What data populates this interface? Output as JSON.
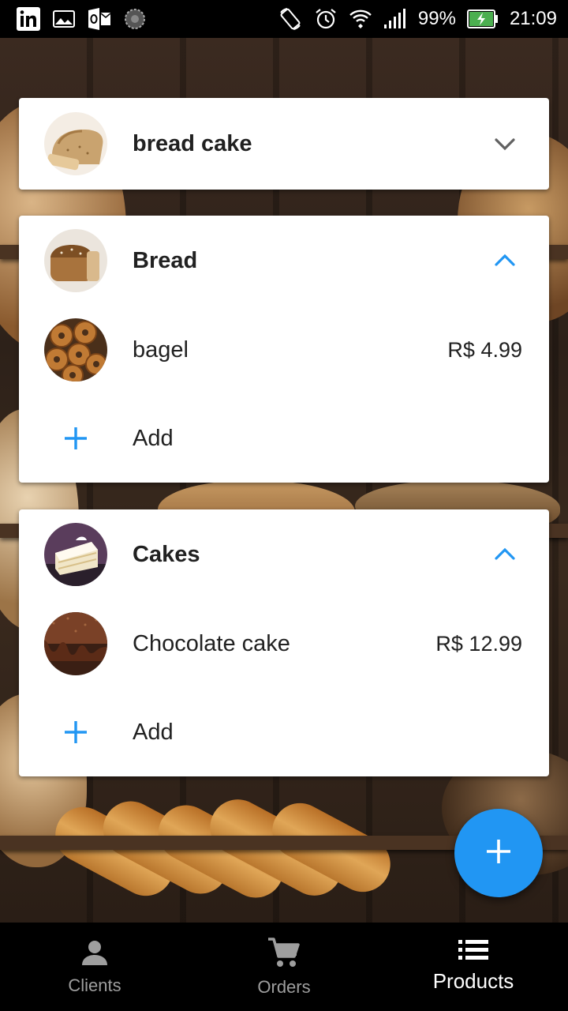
{
  "status_bar": {
    "battery": "99%",
    "time": "21:09",
    "left_icons": [
      "linkedin-icon",
      "gallery-icon",
      "outlook-icon",
      "sync-icon"
    ],
    "right_icons": [
      "rotate-icon",
      "alarm-icon",
      "wifi-icon",
      "signal-icon",
      "battery-charging-icon"
    ]
  },
  "categories": [
    {
      "name": "bread cake",
      "expanded": false,
      "icon": "chevron-down-icon",
      "products": []
    },
    {
      "name": "Bread",
      "expanded": true,
      "icon": "chevron-up-icon",
      "products": [
        {
          "name": "bagel",
          "price": "R$ 4.99"
        }
      ],
      "add_label": "Add"
    },
    {
      "name": "Cakes",
      "expanded": true,
      "icon": "chevron-up-icon",
      "products": [
        {
          "name": "Chocolate cake",
          "price": "R$ 12.99"
        }
      ],
      "add_label": "Add"
    }
  ],
  "fab": {
    "icon": "plus-icon"
  },
  "bottom_nav": {
    "items": [
      {
        "label": "Clients",
        "icon": "person-icon",
        "active": false
      },
      {
        "label": "Orders",
        "icon": "cart-icon",
        "active": false
      },
      {
        "label": "Products",
        "icon": "list-icon",
        "active": true
      }
    ]
  },
  "colors": {
    "accent": "#2196f3",
    "chevron_collapsed": "#616161",
    "nav_inactive": "#9e9e9e",
    "nav_active": "#ffffff"
  }
}
